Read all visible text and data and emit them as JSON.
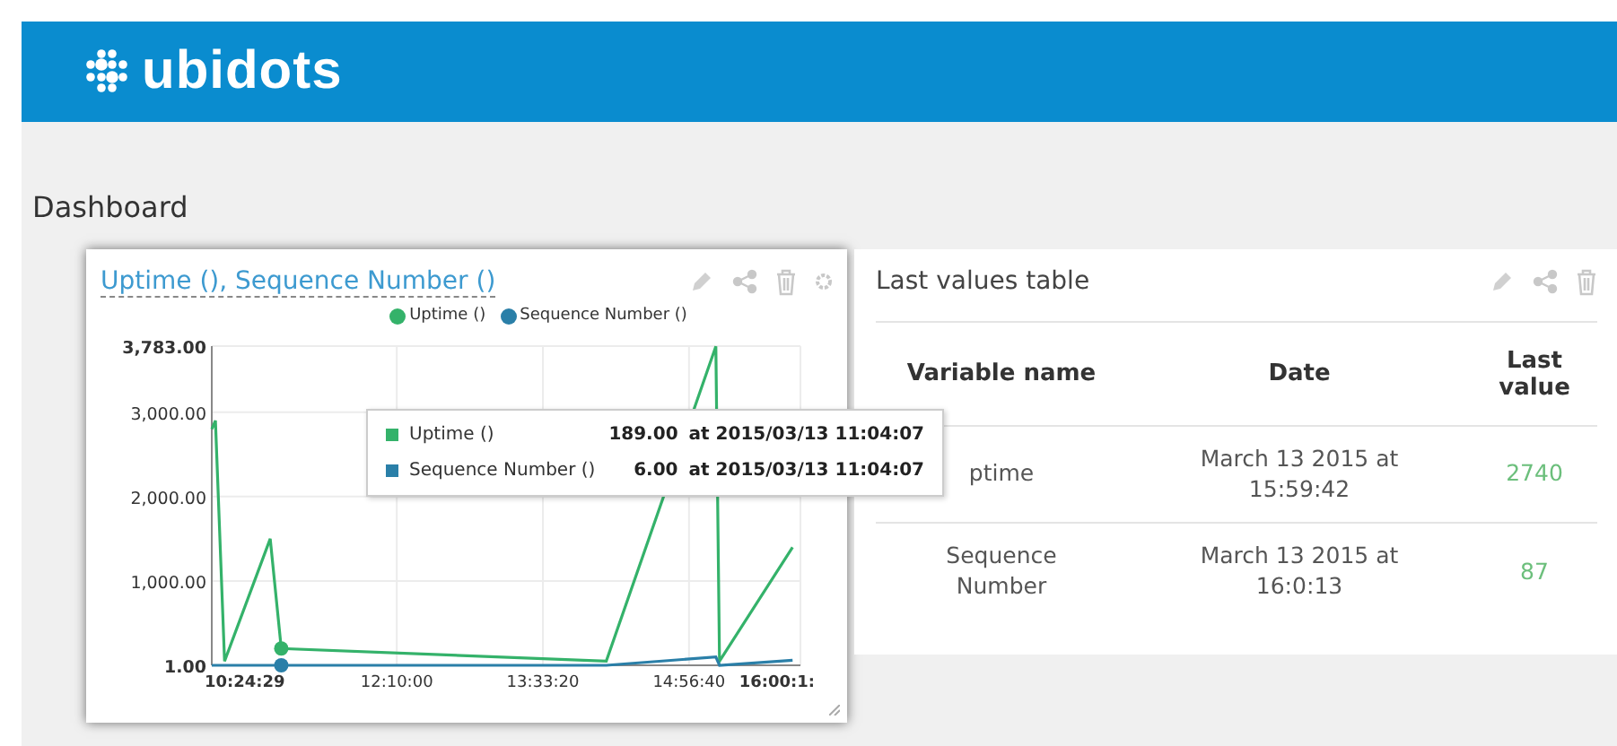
{
  "header": {
    "logo_text": "ubidots"
  },
  "page_title": "Dashboard",
  "chart_widget": {
    "title": "Uptime (), Sequence Number ()",
    "tooltip": [
      {
        "label": "Uptime ()",
        "color": "#34b26a",
        "value": "189.00",
        "time": "at 2015/03/13 11:04:07"
      },
      {
        "label": "Sequence Number ()",
        "color": "#2a7fa8",
        "value": "6.00",
        "time": "at 2015/03/13 11:04:07"
      }
    ],
    "chart_data": {
      "type": "line",
      "x": [
        37469,
        37594,
        37907,
        39469,
        39847,
        50969,
        54719,
        54844,
        57344
      ],
      "series": [
        {
          "name": "Uptime ()",
          "color": "#34b26a",
          "values": [
            2800,
            2900,
            50,
            1500,
            200,
            50,
            3780,
            50,
            1400
          ]
        },
        {
          "name": "Sequence Number ()",
          "color": "#2a7fa8",
          "values": [
            1,
            1,
            1,
            1,
            1,
            1,
            100,
            1,
            60
          ]
        }
      ],
      "xlim": [
        37469,
        57613
      ],
      "ylim": [
        1,
        3783
      ],
      "grid": true,
      "xticks": [
        {
          "value": 37469,
          "label": "10:24:29"
        },
        {
          "value": 43800,
          "label": "12:10:00"
        },
        {
          "value": 48800,
          "label": "13:33:20"
        },
        {
          "value": 53800,
          "label": "14:56:40"
        },
        {
          "value": 57613,
          "label": "16:00:1:"
        }
      ],
      "yticks": [
        {
          "value": 1,
          "label": "1.00"
        },
        {
          "value": 1000,
          "label": "1,000.00"
        },
        {
          "value": 2000,
          "label": "2,000.00"
        },
        {
          "value": 3000,
          "label": "3,000.00"
        },
        {
          "value": 3783,
          "label": "3,783.00"
        }
      ]
    }
  },
  "table_widget": {
    "title": "Last values table",
    "columns": [
      "Variable name",
      "Date",
      "Last value"
    ],
    "rows": [
      {
        "variable": "ptime",
        "date": "March 13 2015 at 15:59:42",
        "value": "2740"
      },
      {
        "variable": "Sequence Number",
        "date": "March 13 2015 at 16:0:13",
        "value": "87"
      }
    ]
  }
}
